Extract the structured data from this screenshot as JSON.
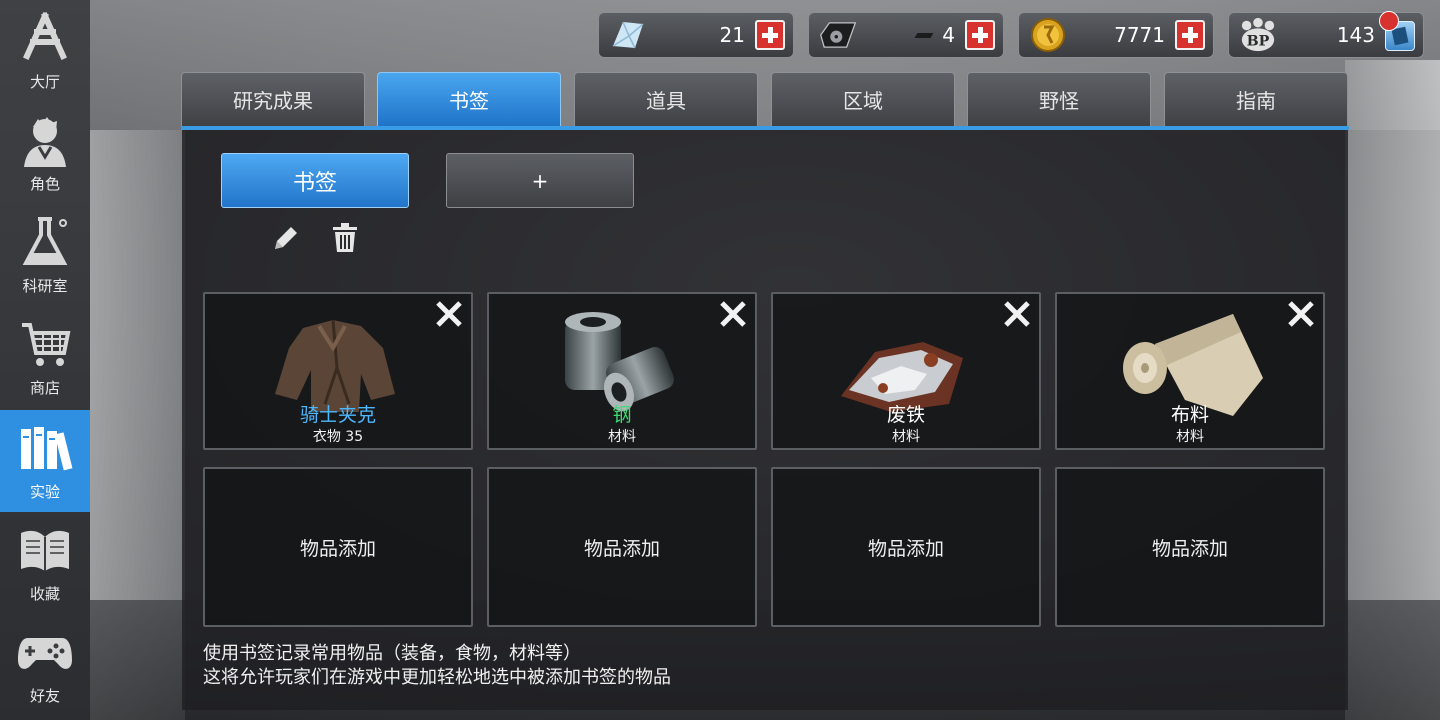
{
  "sidebar": {
    "items": [
      {
        "label": "大厅",
        "icon": "lobby-icon"
      },
      {
        "label": "角色",
        "icon": "character-icon"
      },
      {
        "label": "科研室",
        "icon": "flask-icon"
      },
      {
        "label": "商店",
        "icon": "cart-icon"
      },
      {
        "label": "实验",
        "icon": "books-icon",
        "active": true
      },
      {
        "label": "收藏",
        "icon": "open-book-icon"
      },
      {
        "label": "好友",
        "icon": "gamepad-icon"
      }
    ]
  },
  "resources": [
    {
      "icon": "crystal-icon",
      "value": "21"
    },
    {
      "icon": "hard-drive-icon",
      "value": "4"
    },
    {
      "icon": "gold-coin-icon",
      "value": "7771"
    },
    {
      "icon": "bp-icon",
      "value": "143"
    }
  ],
  "tabs": [
    {
      "label": "研究成果"
    },
    {
      "label": "书签",
      "active": true
    },
    {
      "label": "道具"
    },
    {
      "label": "区域"
    },
    {
      "label": "野怪"
    },
    {
      "label": "指南"
    }
  ],
  "folders": {
    "active_label": "书签",
    "add_label": "+"
  },
  "bookmarks": [
    {
      "name": "骑士夹克",
      "sub": "衣物 35",
      "name_color": "#4db8ff",
      "icon": "jacket-icon"
    },
    {
      "name": "钢",
      "sub": "材料",
      "name_color": "#3ddc74",
      "icon": "steel-icon"
    },
    {
      "name": "废铁",
      "sub": "材料",
      "name_color": "#ffffff",
      "icon": "scrap-metal-icon"
    },
    {
      "name": "布料",
      "sub": "材料",
      "name_color": "#ffffff",
      "icon": "cloth-icon"
    }
  ],
  "empty_slot_label": "物品添加",
  "description": {
    "line1": "使用书签记录常用物品（装备，食物，材料等）",
    "line2": "这将允许玩家们在游戏中更加轻松地选中被添加书签的物品"
  },
  "colors": {
    "accent": "#2f8fe0",
    "plus_button": "#d8322f",
    "notification": "#d8322f"
  }
}
